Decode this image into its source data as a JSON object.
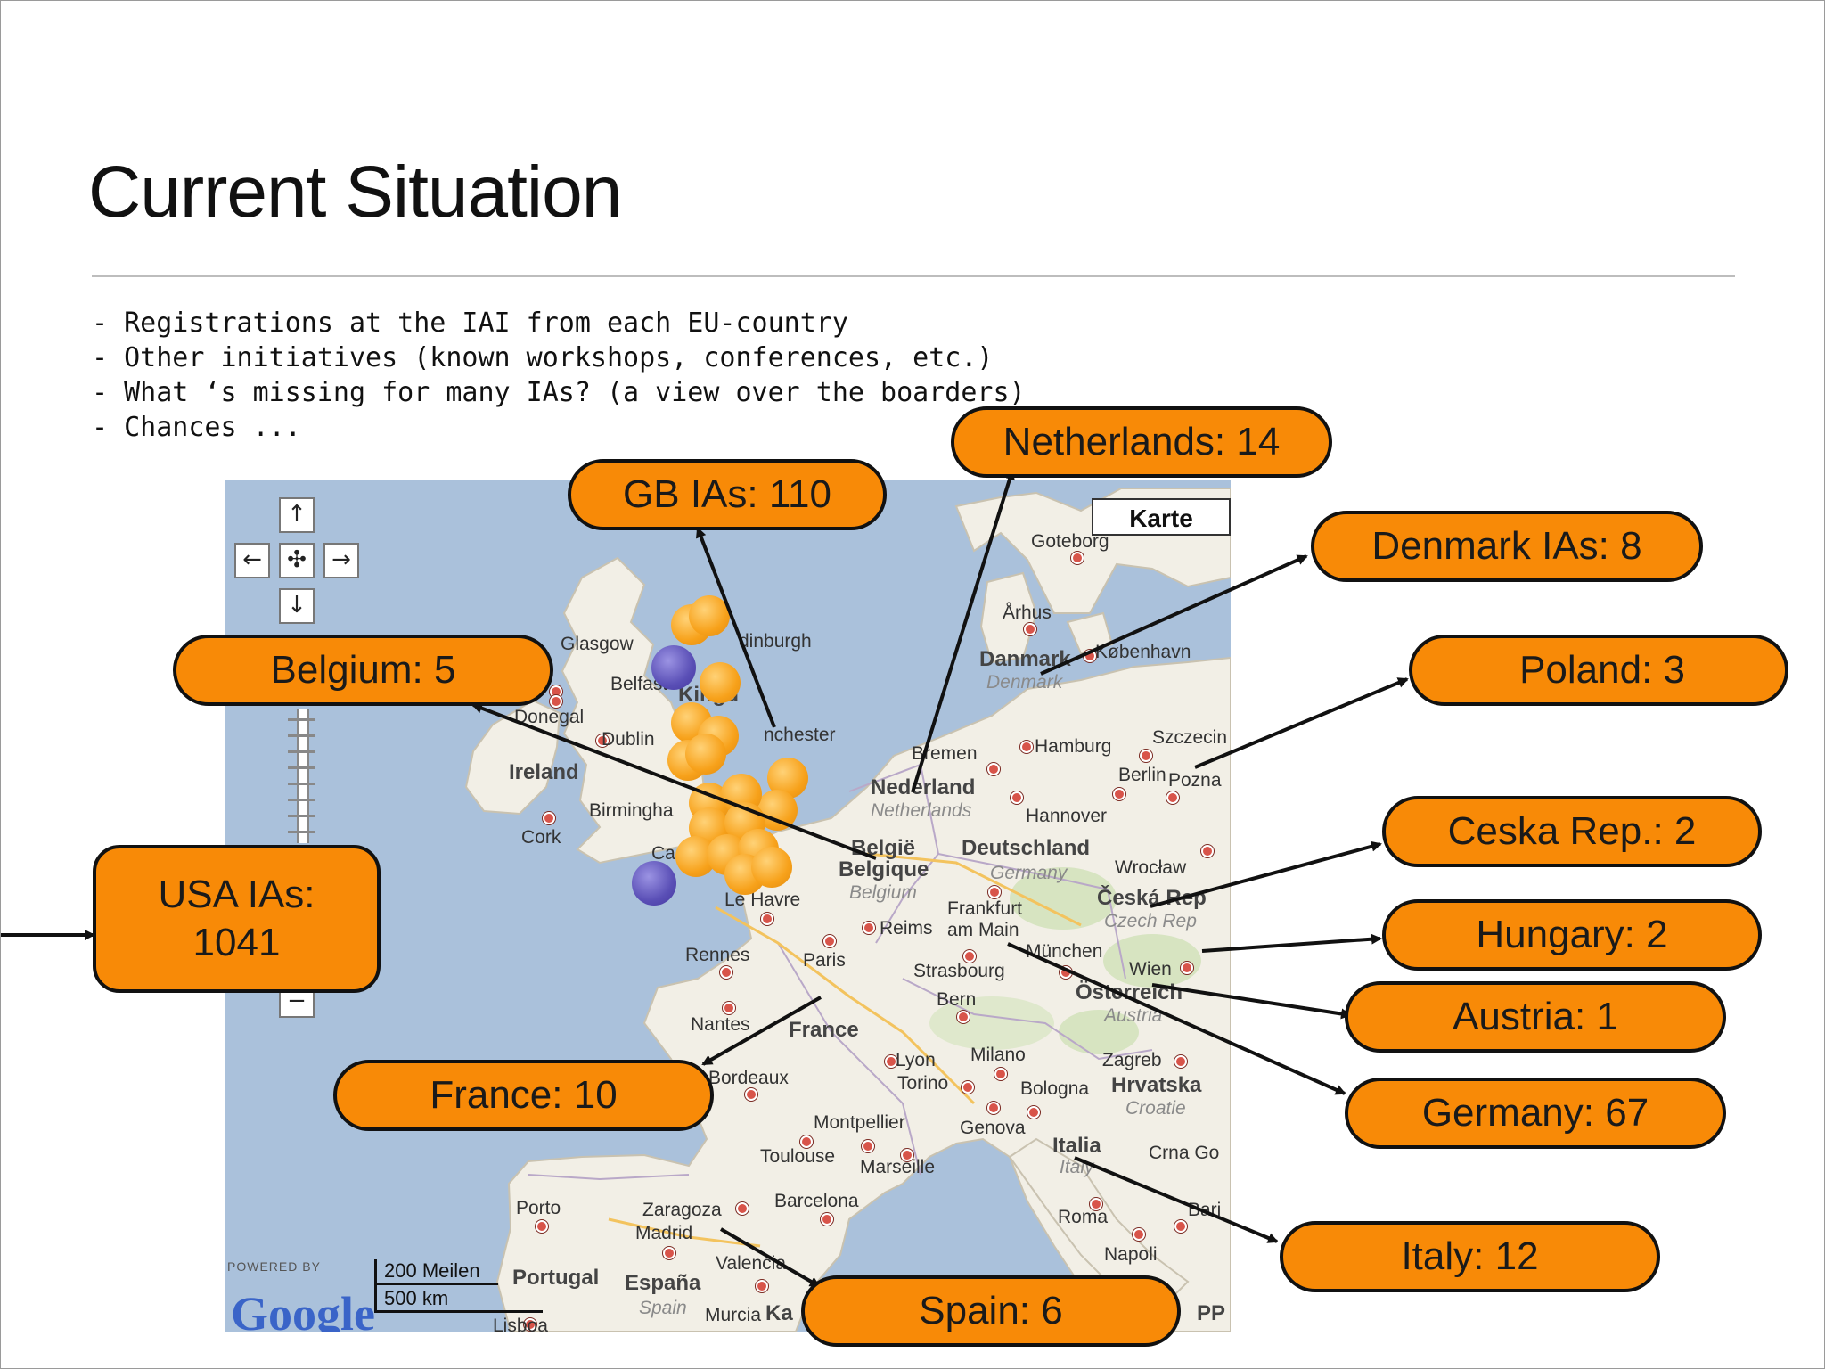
{
  "slide": {
    "title": "Current Situation",
    "bullets": [
      "- Registrations at the IAI from each EU-country",
      "- Other initiatives (known workshops, conferences, etc.)",
      "- What ‘s missing for many IAs? (a view over the boarders)",
      "- Chances ..."
    ]
  },
  "map": {
    "type_button": "Karte",
    "powered_by": "POWERED BY",
    "provider": "Google",
    "scale_top": "200 Meilen",
    "scale_bottom": "500 km",
    "labels": {
      "goteborg": "Goteborg",
      "arhus": "Århus",
      "danmark": "Danmark",
      "denmark": "Denmark",
      "kobenhavn": "København",
      "glasgow": "Glasgow",
      "edinburgh": "dinburgh",
      "belfast": "Belfast",
      "kingdom": "Kingd",
      "donegal": "Donegal",
      "dublin": "Dublin",
      "ireland": "Ireland",
      "manchester": "nchester",
      "cork": "Cork",
      "birmingham": "Birmingha",
      "cardiff": "Ca",
      "bremen": "Bremen",
      "hamburg": "Hamburg",
      "szczecin": "Szczecin",
      "berlin": "Berlin",
      "poznan": "Pozna",
      "nederland": "Nederland",
      "netherlands": "Netherlands",
      "hannover": "Hannover",
      "belgie": "België",
      "belgique": "Belgique",
      "belgium": "Belgium",
      "deutschland": "Deutschland",
      "germany": "Germany",
      "wroclaw": "Wrocław",
      "ceska": "Česká Rep",
      "czech": "Czech Rep",
      "lehavre": "Le Havre",
      "frankfurt": "Frankfurt",
      "ammain": "am Main",
      "reims": "Reims",
      "rennes": "Rennes",
      "paris": "Paris",
      "munchen": "München",
      "strasbourg": "Strasbourg",
      "wien": "Wien",
      "osterreich": "Österreich",
      "austria": "Austria",
      "bern": "Bern",
      "nantes": "Nantes",
      "france": "France",
      "lyon": "Lyon",
      "milano": "Milano",
      "zagreb": "Zagreb",
      "hrvatska": "Hrvatska",
      "croatie": "Croatie",
      "bordeaux": "Bordeaux",
      "torino": "Torino",
      "bologna": "Bologna",
      "genova": "Genova",
      "montpellier": "Montpellier",
      "toulouse": "Toulouse",
      "marseille": "Marseille",
      "italia": "Italia",
      "italy": "Italy",
      "crnagora": "Crna Go",
      "porto": "Porto",
      "zaragoza": "Zaragoza",
      "barcelona": "Barcelona",
      "roma": "Roma",
      "madrid": "Madrid",
      "bari": "Bari",
      "napoli": "Napoli",
      "portugal": "Portugal",
      "espana": "España",
      "spain": "Spain",
      "valencia": "Valencia",
      "lisboa": "Lisboa",
      "murcia": "Murcia",
      "ka": "Ka",
      "pp": "PP"
    }
  },
  "callouts": {
    "gb": "GB IAs: 110",
    "netherlands": "Netherlands: 14",
    "denmark": "Denmark IAs: 8",
    "belgium": "Belgium: 5",
    "poland": "Poland: 3",
    "usa_line1": "USA IAs:",
    "usa_line2": "1041",
    "ceska": "Ceska Rep.: 2",
    "hungary": "Hungary: 2",
    "austria": "Austria: 1",
    "france": "France: 10",
    "germany": "Germany: 67",
    "italy": "Italy: 12",
    "spain": "Spain: 6"
  },
  "colors": {
    "callout_fill": "#f88a07",
    "bubble_orange": "#f7a11a",
    "bubble_purple": "#5a4fb6",
    "sea": "#aac1db",
    "land": "#f2efe6"
  },
  "icons": [
    "arrow-up-icon",
    "arrow-left-icon",
    "pan-center-icon",
    "arrow-right-icon",
    "arrow-down-icon",
    "zoom-out-icon"
  ]
}
